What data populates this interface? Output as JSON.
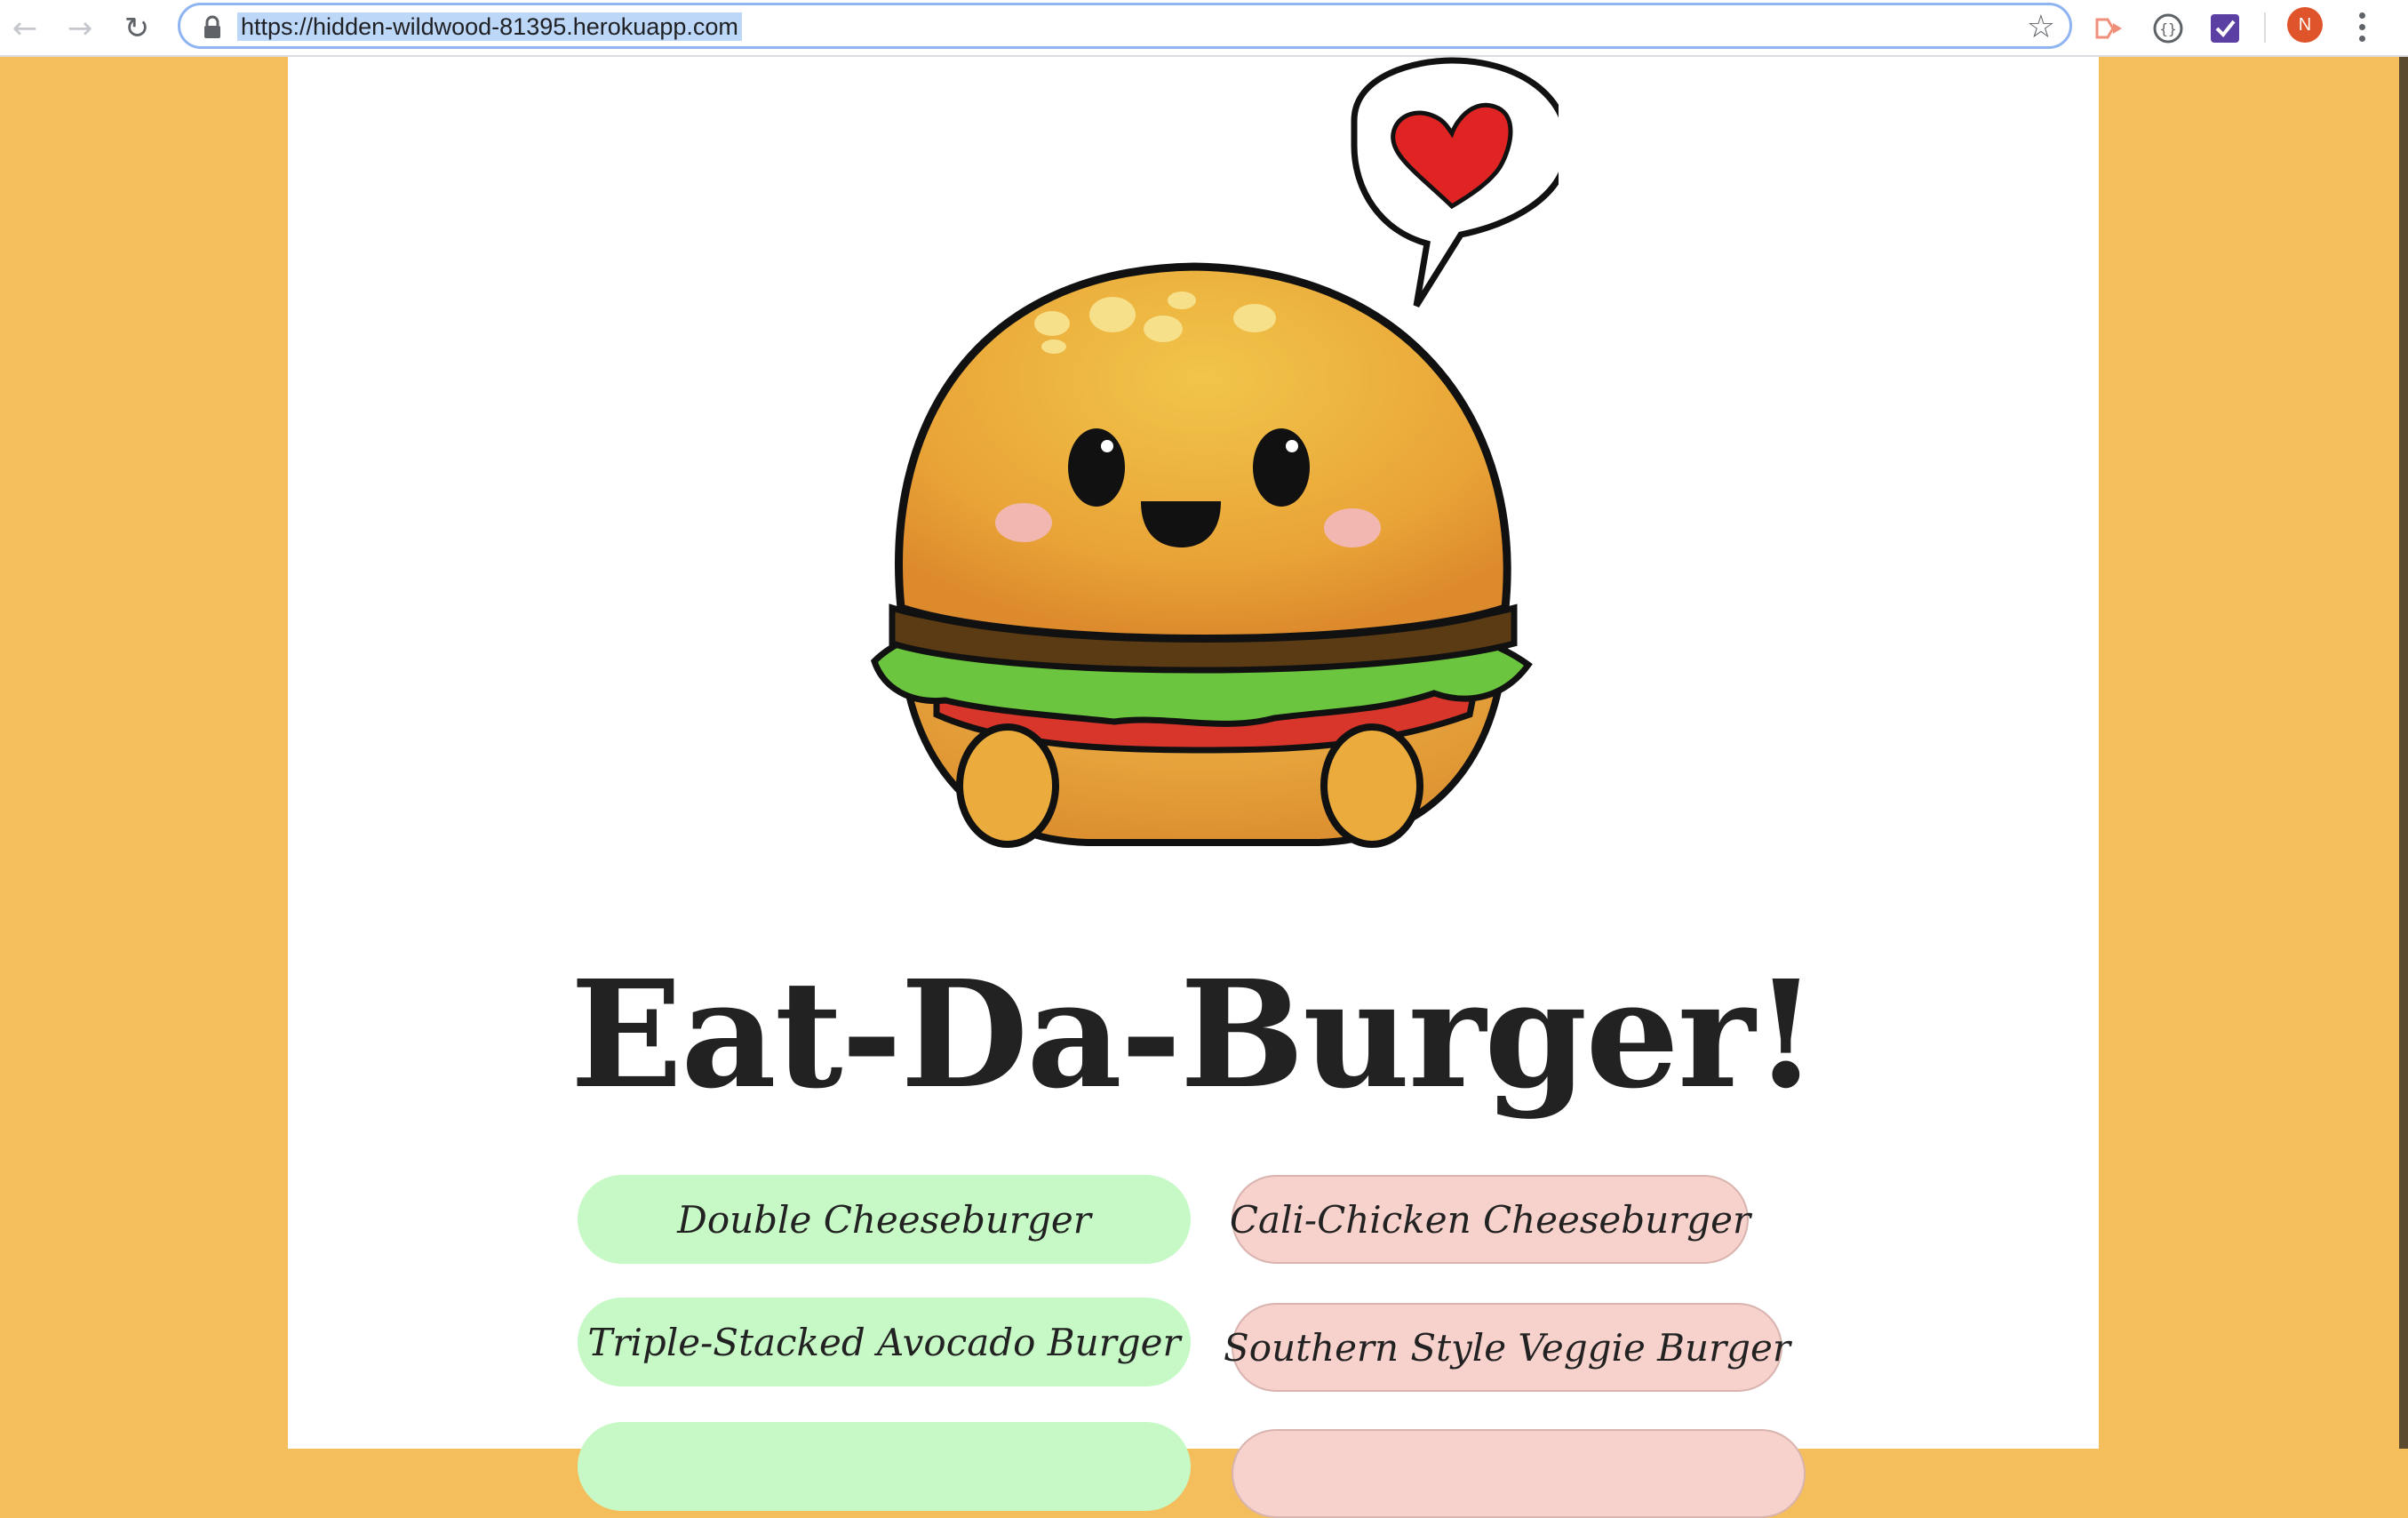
{
  "browser": {
    "url": "https://hidden-wildwood-81395.herokuapp.com",
    "avatar_initial": "N"
  },
  "page": {
    "title": "Eat-Da-Burger!",
    "burgers_to_eat": [
      "Double Cheeseburger",
      "Triple-Stacked Avocado Burger"
    ],
    "burgers_devoured": [
      "Cali-Chicken Cheeseburger",
      "Southern Style Veggie Burger"
    ]
  },
  "colors": {
    "background": "#f4be5c",
    "to_eat_button": "#c6f9c6",
    "devoured_button": "#f7d2cc"
  }
}
